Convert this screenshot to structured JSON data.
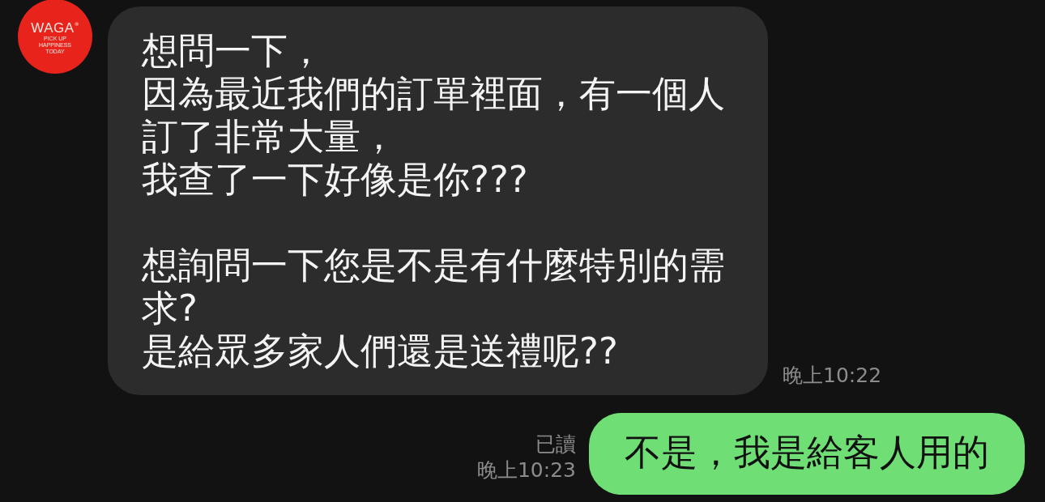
{
  "messages": [
    {
      "kind": "incoming",
      "avatar": {
        "logo": "WAGA",
        "mark": "®",
        "tagline": [
          "PICK UP",
          "HAPPINESS",
          "TODAY"
        ]
      },
      "paragraphs": [
        [
          "想問一下，",
          "因為最近我們的訂單裡面，有一個人",
          "訂了非常大量，",
          "我查了一下好像是你???"
        ],
        [
          "想詢問一下您是不是有什麼特別的需求?",
          "是給眾多家人們還是送禮呢??"
        ]
      ],
      "time": "晚上10:22"
    },
    {
      "kind": "outgoing",
      "text": "不是，我是給客人用的",
      "read": "已讀",
      "time": "晚上10:23"
    }
  ]
}
